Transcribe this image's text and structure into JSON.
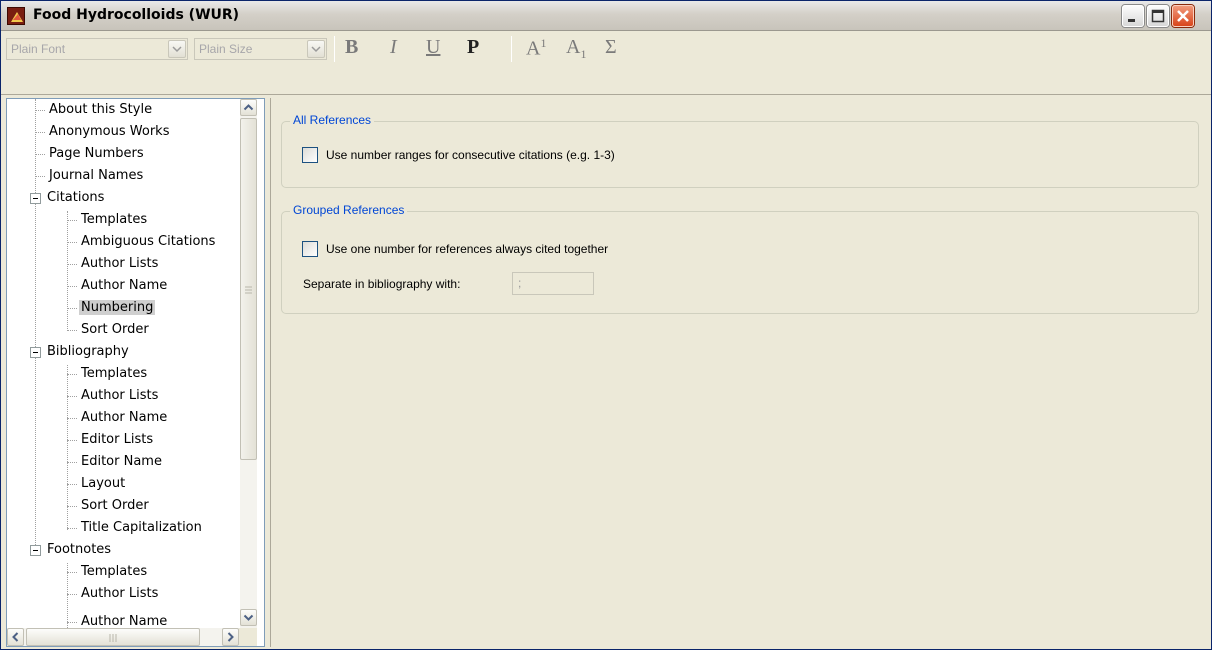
{
  "window": {
    "title": "Food Hydrocolloids (WUR)",
    "buttons": {
      "minimize": "minimize",
      "maximize": "maximize",
      "close": "close"
    }
  },
  "toolbar": {
    "font": {
      "value": "Plain Font"
    },
    "size": {
      "value": "Plain Size"
    },
    "format_buttons": {
      "bold": "B",
      "italic": "I",
      "underline": "U",
      "plain": "P",
      "superscript": "A",
      "superscript_mark": "1",
      "subscript": "A",
      "subscript_mark": "1",
      "symbol": "Σ"
    }
  },
  "tree": {
    "items": [
      {
        "label": "About this Style"
      },
      {
        "label": "Anonymous Works"
      },
      {
        "label": "Page Numbers"
      },
      {
        "label": "Journal Names"
      },
      {
        "label": "Citations"
      },
      {
        "label": "Templates"
      },
      {
        "label": "Ambiguous Citations"
      },
      {
        "label": "Author Lists"
      },
      {
        "label": "Author Name"
      },
      {
        "label": "Numbering"
      },
      {
        "label": "Sort Order"
      },
      {
        "label": "Bibliography"
      },
      {
        "label": "Templates"
      },
      {
        "label": "Author Lists"
      },
      {
        "label": "Author Name"
      },
      {
        "label": "Editor Lists"
      },
      {
        "label": "Editor Name"
      },
      {
        "label": "Layout"
      },
      {
        "label": "Sort Order"
      },
      {
        "label": "Title Capitalization"
      },
      {
        "label": "Footnotes"
      },
      {
        "label": "Templates"
      },
      {
        "label": "Author Lists"
      },
      {
        "label": "Author Name"
      }
    ],
    "selected": "Numbering"
  },
  "all_references": {
    "title": "All References",
    "checkbox_label": "Use number ranges for consecutive citations (e.g. 1-3)",
    "checked": false
  },
  "grouped_references": {
    "title": "Grouped References",
    "checkbox_label": "Use one number for references always cited together",
    "checked": false,
    "separator_label": "Separate in bibliography with:",
    "separator_value": ";"
  }
}
